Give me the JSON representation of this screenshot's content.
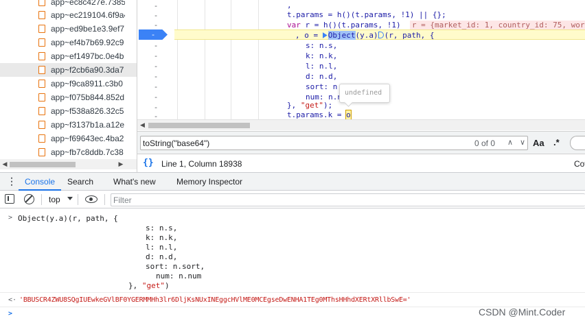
{
  "file_tree": {
    "items": [
      {
        "label": "app~ec8c427e.7385",
        "selected": false
      },
      {
        "label": "app~ec219104.6f9a4",
        "selected": false
      },
      {
        "label": "app~ed9be1e3.9ef7",
        "selected": false
      },
      {
        "label": "app~ef4b7b69.92c9",
        "selected": false
      },
      {
        "label": "app~ef1497bc.0e4b",
        "selected": false
      },
      {
        "label": "app~f2cb6a90.3da7",
        "selected": true
      },
      {
        "label": "app~f9ca8911.c3b0",
        "selected": false
      },
      {
        "label": "app~f075b844.852d",
        "selected": false
      },
      {
        "label": "app~f538a826.32c5",
        "selected": false
      },
      {
        "label": "app~f3137b1a.a12e",
        "selected": false
      },
      {
        "label": "app~f69643ec.4ba2",
        "selected": false
      },
      {
        "label": "app~fb7c8ddb.7c38",
        "selected": false
      }
    ],
    "scroll_left": "◀",
    "scroll_right": "▶"
  },
  "editor": {
    "gutter": [
      "-",
      "-",
      "-",
      "-",
      "-",
      "-",
      "-",
      "-",
      "-",
      "-",
      "-"
    ],
    "breakpoint_glyph": "-",
    "lines": {
      "l0": ",",
      "l1a": "t.params = h()(t.params, !1) || {};",
      "l2a": "var",
      "l2b": " r = h()(t.params, !1)",
      "l2c": "r = {market_id: 1, country_id: 75, wor",
      "l3a": ", o = ",
      "l3b": "Object",
      "l3c": "(y.a)",
      "l3d": "(r, path, {",
      "l4": "s: n.s,",
      "l5": "k: n.k,",
      "l6": "l: n.l,",
      "l7": "d: n.d,",
      "l8": "sort: n.sort,",
      "l9": "num: n.num",
      "l10a": "}, ",
      "l10b": "\"get\"",
      "l10c": ");",
      "l11a": "t.params.k = ",
      "l11b": "o"
    },
    "tooltip": "undefined",
    "hscroll_left": "◀"
  },
  "search": {
    "value": "toString(\"base64\")",
    "count": "0 of 0",
    "prev": "∧",
    "next": "∨",
    "case_label": "Aa",
    "regex_label": ".*"
  },
  "status": {
    "braces": "{}",
    "position": "Line 1, Column 18938",
    "right_label": "Cov"
  },
  "drawer": {
    "menu_glyph": "⋮",
    "tabs": [
      "Console",
      "Search",
      "What's new",
      "Memory Inspector"
    ],
    "active_tab": "Console"
  },
  "console_toolbar": {
    "context": "top",
    "filter_placeholder": "Filter"
  },
  "console": {
    "input_prompt": ">",
    "input_lines": [
      "Object(y.a)(r, path, {",
      "s: n.s,",
      "k: n.k,",
      "l: n.l,",
      "d: n.d,",
      "sort: n.sort,",
      "num: n.num"
    ],
    "input_close_a": "}, ",
    "input_close_b": "\"get\"",
    "input_close_c": ")",
    "result_prompt": "<·",
    "result": "'BBUSCR4ZWU8SQgIUEwkeGVlBF0YGERMMHh3lr6DljKsNUxINEggcHVlME0MCEgseDwENHA1TEg0MThsHHhdXERtXRllbSwE='",
    "next_prompt": ">"
  },
  "watermark": "CSDN @Mint.Coder",
  "colors": {
    "accent": "#1a73e8",
    "paused_line": "#fffbcb",
    "breakpoint": "#3b82f6",
    "file_icon": "#e8710a",
    "string": "#c41a16"
  }
}
